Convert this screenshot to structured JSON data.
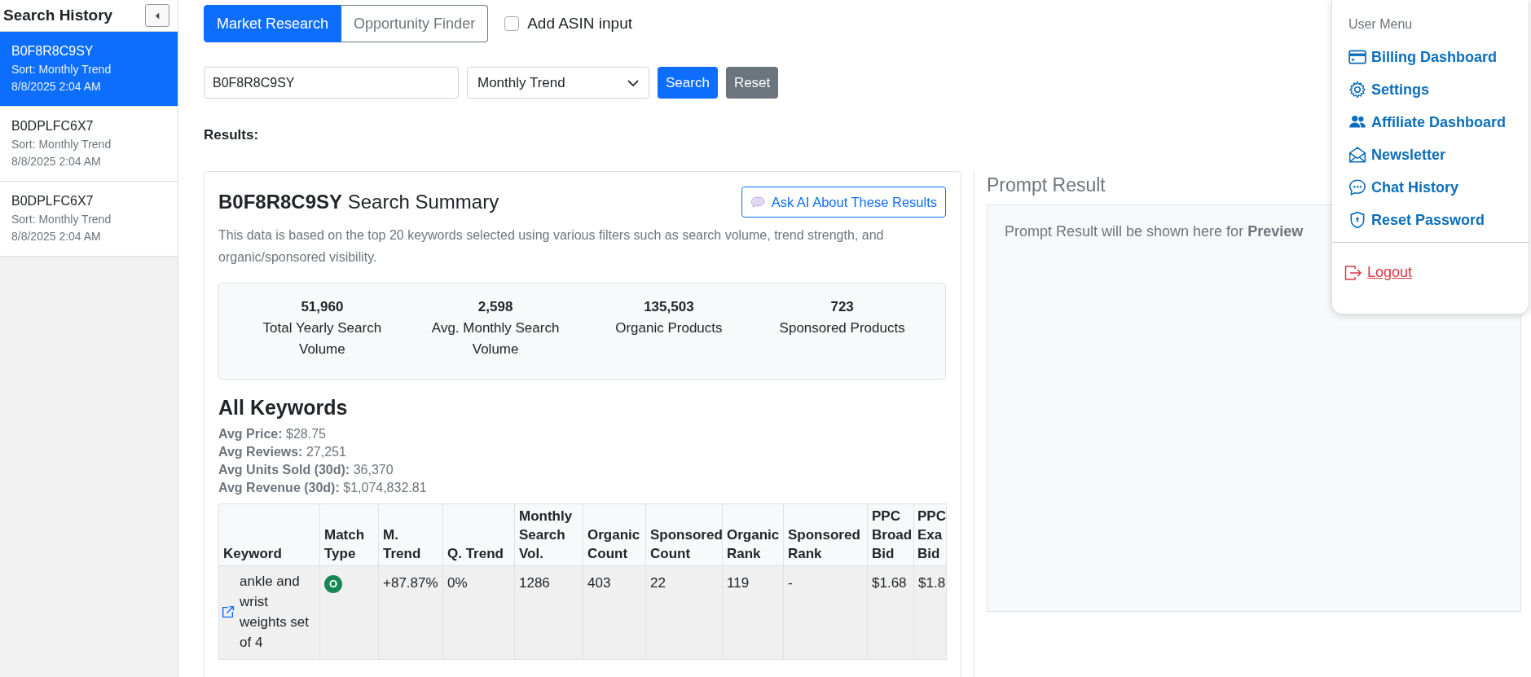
{
  "sidebar": {
    "title": "Search History",
    "items": [
      {
        "asin": "B0F8R8C9SY",
        "sort": "Sort: Monthly Trend",
        "date": "8/8/2025 2:04 AM",
        "selected": true
      },
      {
        "asin": "B0DPLFC6X7",
        "sort": "Sort: Monthly Trend",
        "date": "8/8/2025 2:04 AM",
        "selected": false
      },
      {
        "asin": "B0DPLFC6X7",
        "sort": "Sort: Monthly Trend",
        "date": "8/8/2025 2:04 AM",
        "selected": false
      }
    ]
  },
  "mode_tabs": [
    {
      "label": "Market Research",
      "selected": true
    },
    {
      "label": "Opportunity Finder",
      "selected": false
    }
  ],
  "add_asin": {
    "label": "Add ASIN input",
    "checked": false
  },
  "search": {
    "value": "B0F8R8C9SY",
    "sort": "Monthly Trend",
    "search_button": "Search",
    "reset_button": "Reset"
  },
  "results_label": "Results:",
  "summary": {
    "asin": "B0F8R8C9SY",
    "title": "Search Summary",
    "ask_button": "Ask AI About These Results",
    "description": "This data is based on the top 20 keywords selected using various filters such as search volume, trend strength, and organic/sponsored visibility.",
    "stats": [
      {
        "value": "51,960",
        "label": "Total Yearly Search Volume"
      },
      {
        "value": "2,598",
        "label": "Avg. Monthly Search Volume"
      },
      {
        "value": "135,503",
        "label": "Organic Products"
      },
      {
        "value": "723",
        "label": "Sponsored Products"
      }
    ]
  },
  "keywords": {
    "title": "All Keywords",
    "averages": [
      {
        "label": "Avg Price:",
        "value": "$28.75"
      },
      {
        "label": "Avg Reviews:",
        "value": "27,251"
      },
      {
        "label": "Avg Units Sold (30d):",
        "value": "36,370"
      },
      {
        "label": "Avg Revenue (30d):",
        "value": "$1,074,832.81"
      }
    ],
    "table": {
      "columns": [
        {
          "label": "Keyword",
          "kind": "keyword"
        },
        {
          "label": "Match Type",
          "kind": "badge"
        },
        {
          "label": "M. Trend",
          "kind": "text"
        },
        {
          "label": "Q. Trend",
          "kind": "text"
        },
        {
          "label": "Monthly Search Vol.",
          "kind": "text"
        },
        {
          "label": "Organic Count",
          "kind": "text"
        },
        {
          "label": "Sponsored Count",
          "kind": "text"
        },
        {
          "label": "Organic Rank",
          "kind": "text"
        },
        {
          "label": "Sponsored Rank",
          "kind": "text"
        },
        {
          "label": "PPC Broad Bid",
          "kind": "text"
        },
        {
          "label": "PPC Exa Bid",
          "kind": "text"
        }
      ],
      "rows": [
        {
          "cells": [
            "ankle and wrist weights set of 4",
            "O",
            "+87.87%",
            "0%",
            "1286",
            "403",
            "22",
            "119",
            "-",
            "$1.68",
            "$1.8"
          ]
        }
      ]
    }
  },
  "prompt_result": {
    "title": "Prompt Result",
    "text": "Prompt Result will be shown here for **Preview**"
  },
  "user_menu": {
    "title": "User Menu",
    "items": [
      {
        "label": "Billing Dashboard"
      },
      {
        "label": "Settings"
      },
      {
        "label": "Affiliate Dashboard"
      },
      {
        "label": "Newsletter"
      },
      {
        "label": "Chat History"
      },
      {
        "label": "Reset Password"
      }
    ],
    "logout": "Logout"
  }
}
